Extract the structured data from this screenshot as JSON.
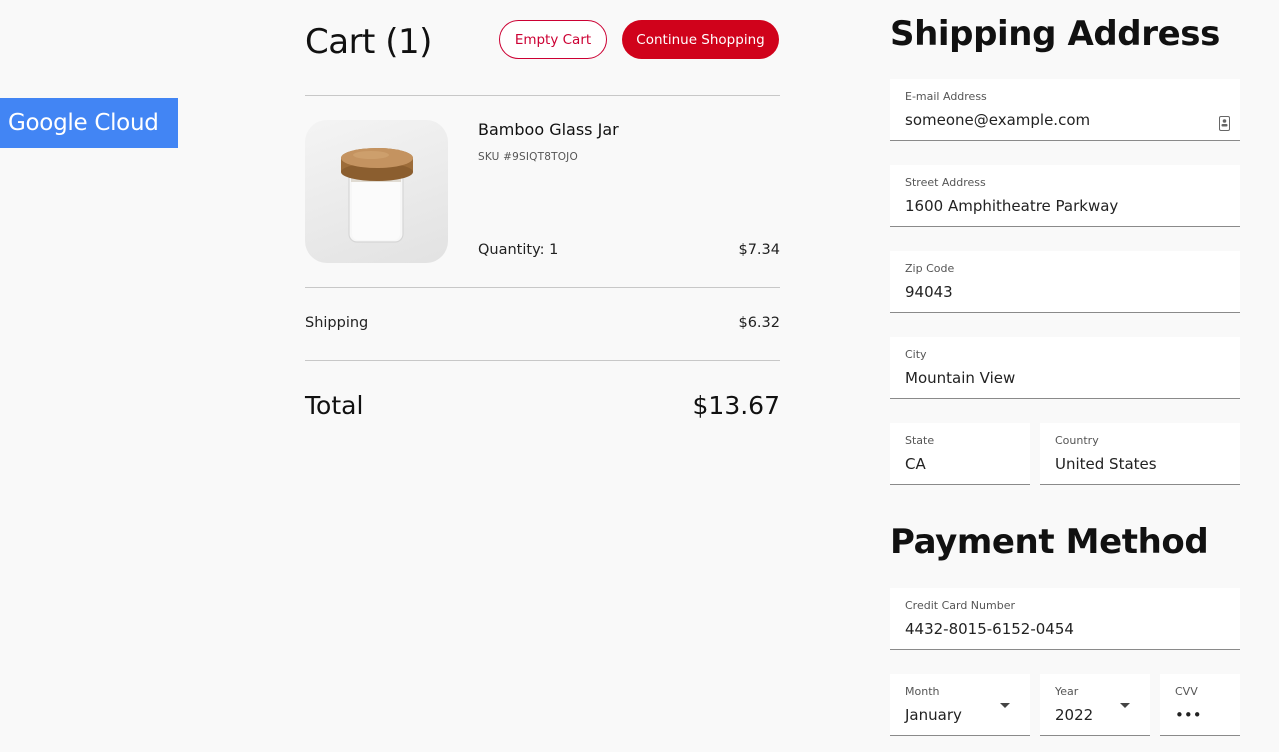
{
  "brand": {
    "badge": "Google Cloud"
  },
  "cart": {
    "title": "Cart (1)",
    "empty_label": "Empty Cart",
    "continue_label": "Continue Shopping",
    "item": {
      "name": "Bamboo Glass Jar",
      "sku": "SKU #9SIQT8TOJO",
      "quantity": "Quantity: 1",
      "price": "$7.34"
    },
    "shipping_label": "Shipping",
    "shipping_value": "$6.32",
    "total_label": "Total",
    "total_value": "$13.67"
  },
  "shipping": {
    "title": "Shipping Address",
    "email": {
      "label": "E-mail Address",
      "value": "someone@example.com"
    },
    "street": {
      "label": "Street Address",
      "value": "1600 Amphitheatre Parkway"
    },
    "zip": {
      "label": "Zip Code",
      "value": "94043"
    },
    "city": {
      "label": "City",
      "value": "Mountain View"
    },
    "state": {
      "label": "State",
      "value": "CA"
    },
    "country": {
      "label": "Country",
      "value": "United States"
    }
  },
  "payment": {
    "title": "Payment Method",
    "card": {
      "label": "Credit Card Number",
      "value": "4432-8015-6152-0454"
    },
    "month": {
      "label": "Month",
      "value": "January"
    },
    "year": {
      "label": "Year",
      "value": "2022"
    },
    "cvv": {
      "label": "CVV",
      "value": "•••"
    }
  },
  "colors": {
    "accent": "#d0021b",
    "brand_blue": "#4285f4",
    "background": "#f9f9f9"
  }
}
